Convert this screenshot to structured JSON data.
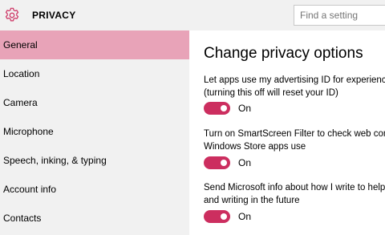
{
  "header": {
    "title": "PRIVACY",
    "search_placeholder": "Find a setting"
  },
  "sidebar": {
    "items": [
      {
        "label": "General",
        "active": true
      },
      {
        "label": "Location",
        "active": false
      },
      {
        "label": "Camera",
        "active": false
      },
      {
        "label": "Microphone",
        "active": false
      },
      {
        "label": "Speech, inking, & typing",
        "active": false
      },
      {
        "label": "Account info",
        "active": false
      },
      {
        "label": "Contacts",
        "active": false
      }
    ]
  },
  "main": {
    "heading": "Change privacy options",
    "options": [
      {
        "line1": "Let apps use my advertising ID for experience",
        "line2": "(turning this off will reset your ID)",
        "state": "On"
      },
      {
        "line1": "Turn on SmartScreen Filter to check web cont",
        "line2": "Windows Store apps use",
        "state": "On"
      },
      {
        "line1": "Send Microsoft info about how I write to help",
        "line2": "and writing in the future",
        "state": "On"
      }
    ]
  },
  "colors": {
    "accent": "#cc2e5f",
    "active_nav": "#e8a3b8",
    "sidebar_bg": "#f1f1f1",
    "content_bg": "#ffffff"
  },
  "icons": {
    "app": "gear-icon"
  }
}
